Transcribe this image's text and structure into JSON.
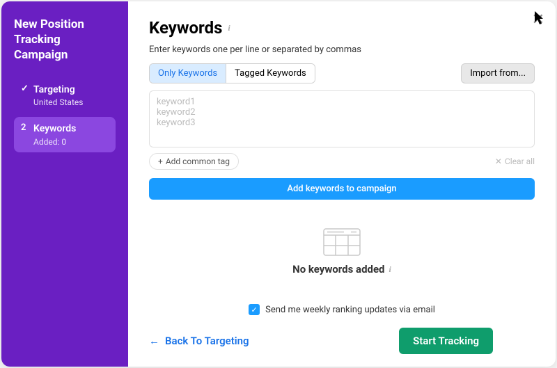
{
  "sidebar": {
    "title": "New Position Tracking Campaign",
    "steps": [
      {
        "icon": "✓",
        "title": "Targeting",
        "sub": "United States"
      },
      {
        "icon": "2",
        "title": "Keywords",
        "sub": "Added: 0"
      }
    ]
  },
  "header": {
    "title": "Keywords",
    "subtitle": "Enter keywords one per line or separated by commas"
  },
  "tabs": {
    "only": "Only Keywords",
    "tagged": "Tagged Keywords"
  },
  "import_label": "Import from...",
  "textarea_placeholder": "keyword1\nkeyword2\nkeyword3",
  "add_tag_label": "Add common tag",
  "clear_label": "Clear all",
  "add_keywords_label": "Add keywords to campaign",
  "empty_label": "No keywords added",
  "checkbox_label": "Send me weekly ranking updates via email",
  "checkbox_checked": true,
  "back_label": "Back To Targeting",
  "start_label": "Start Tracking"
}
